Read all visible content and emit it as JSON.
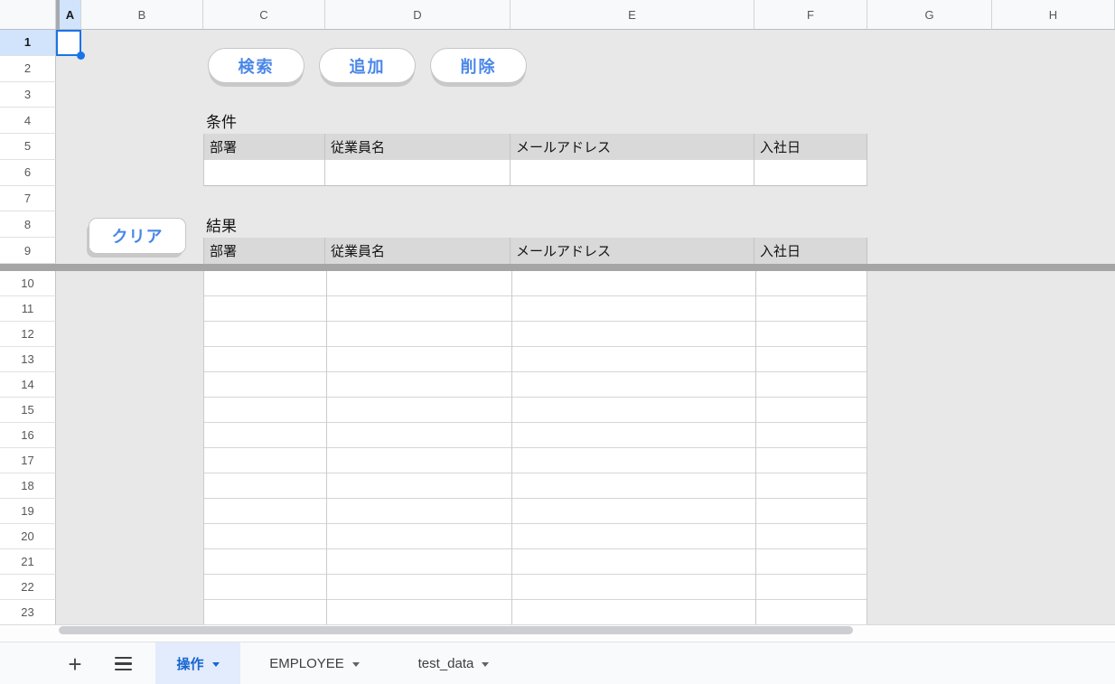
{
  "spreadsheet": {
    "column_headers": [
      "A",
      "B",
      "C",
      "D",
      "E",
      "F",
      "G",
      "H"
    ],
    "row_numbers": [
      "1",
      "2",
      "3",
      "4",
      "5",
      "6",
      "7",
      "8",
      "9",
      "10",
      "11",
      "12",
      "13",
      "14",
      "15",
      "16",
      "17",
      "18",
      "19",
      "20",
      "21",
      "22",
      "23"
    ],
    "selected_column": "A",
    "selected_row": "1"
  },
  "toolbar": {
    "search": "検索",
    "add": "追加",
    "delete": "削除",
    "clear": "クリア"
  },
  "condition_section": {
    "label": "条件",
    "headers": [
      "部署",
      "従業員名",
      "メールアドレス",
      "入社日"
    ]
  },
  "result_section": {
    "label": "結果",
    "headers": [
      "部署",
      "従業員名",
      "メールアドレス",
      "入社日"
    ]
  },
  "sheet_tabs": {
    "tabs": [
      {
        "label": "操作",
        "active": true
      },
      {
        "label": "EMPLOYEE",
        "active": false
      },
      {
        "label": "test_data",
        "active": false
      }
    ]
  },
  "colors": {
    "selection_blue": "#1a73e8",
    "button_text_blue": "#4a86e8",
    "active_tab_blue": "#1765d1",
    "active_tab_bg": "#e3ecfc",
    "table_header_gray": "#d9d9d9",
    "canvas_gray": "#e8e8e8",
    "selected_header_bg": "#d2e3fc",
    "freeze_bar_gray": "#a5a5a5"
  }
}
